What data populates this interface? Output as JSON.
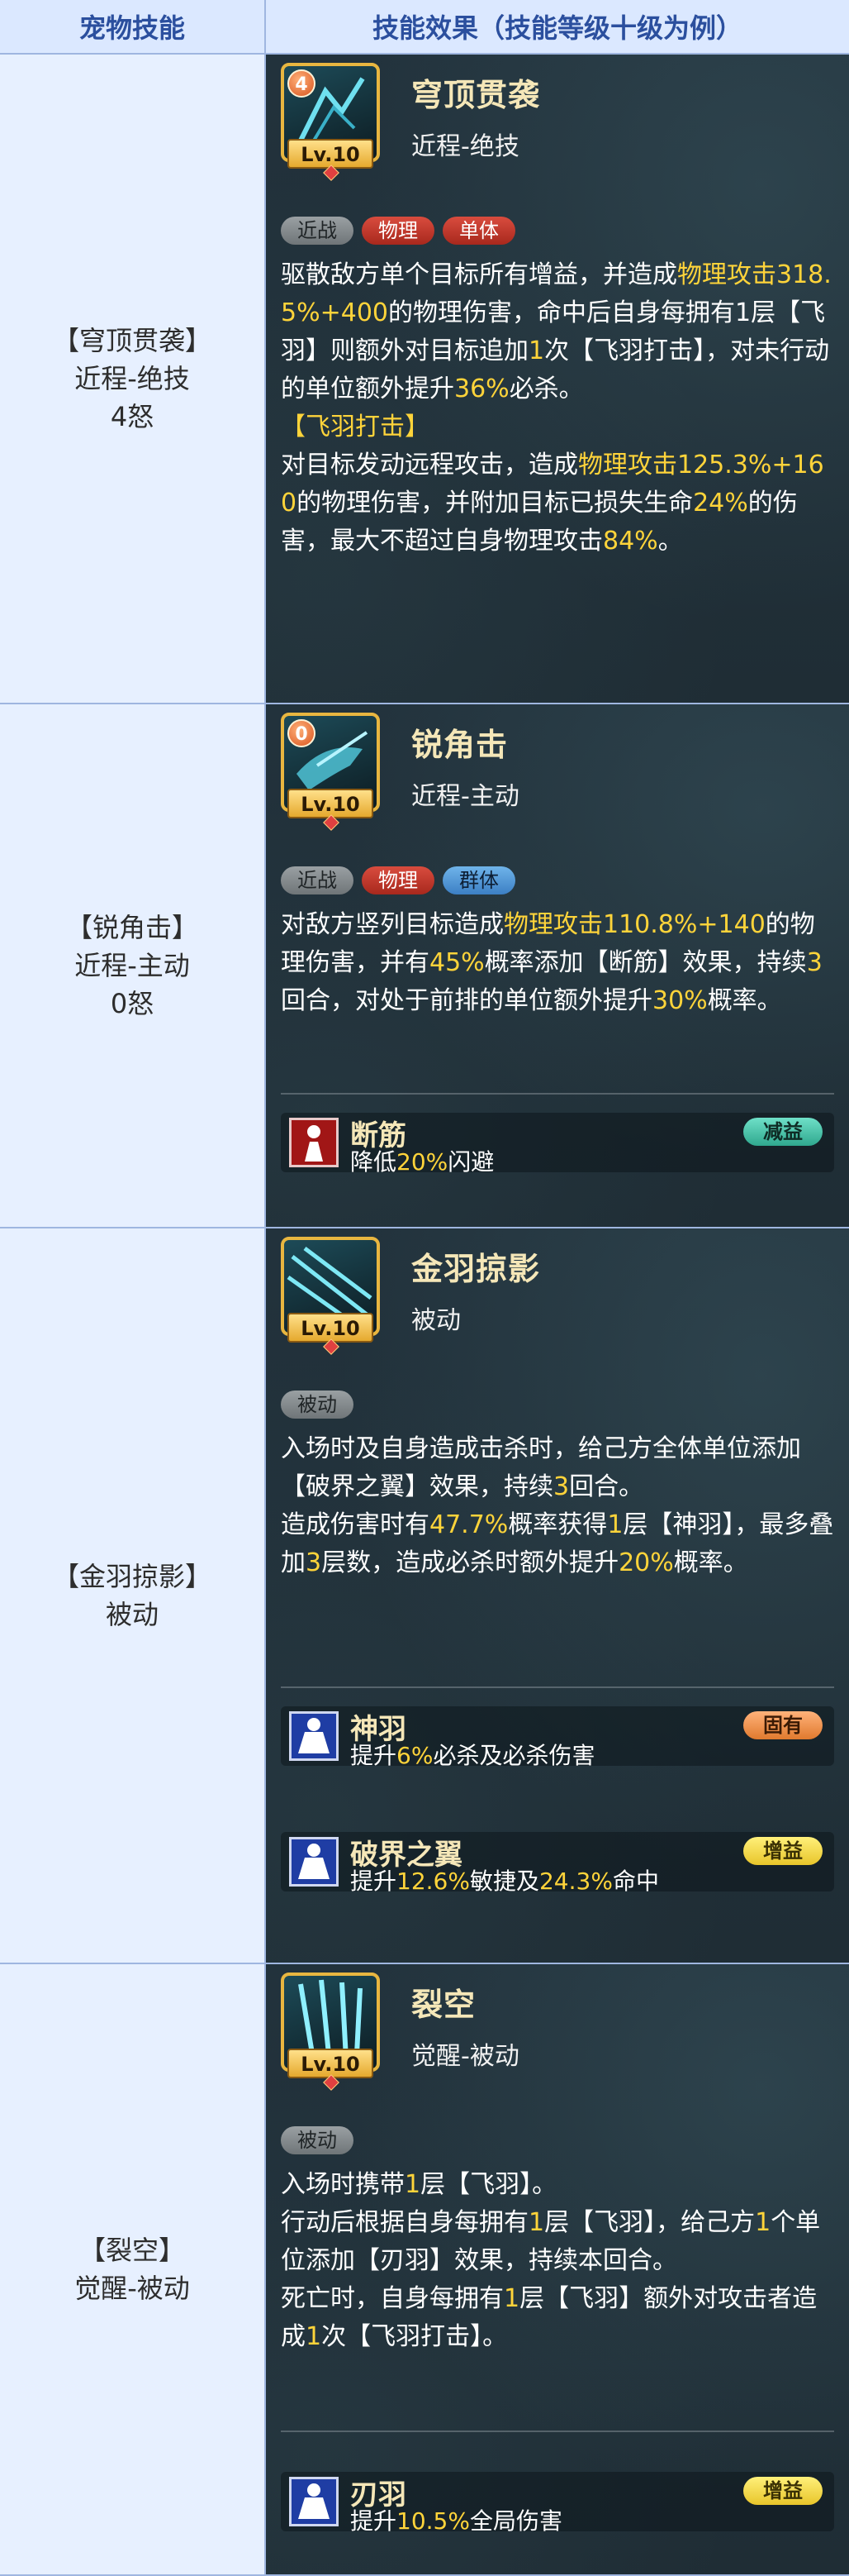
{
  "header": {
    "col1": "宠物技能",
    "col2": "技能效果（技能等级十级为例）"
  },
  "skills": [
    {
      "left": [
        "【穹顶贯袭】",
        "近程-绝技",
        "4怒"
      ],
      "name": "穹顶贯袭",
      "type": "近程-绝技",
      "level": "Lv.10",
      "rage": "4",
      "tags": [
        "近战",
        "物理",
        "单体"
      ],
      "desc": [
        {
          "t": "驱散敌方单个目标所有增益，并造成"
        },
        {
          "t": "物理攻击318.5%+400",
          "y": true
        },
        {
          "t": "的物理伤害，命中后自身每拥有1层【飞羽】则额外对目标追加"
        },
        {
          "t": "1",
          "y": true
        },
        {
          "t": "次【飞羽打击】，对未行动的单位额外提升"
        },
        {
          "t": "36%",
          "y": true
        },
        {
          "t": "必杀。"
        }
      ],
      "sub_title": "【飞羽打击】",
      "sub_desc": [
        {
          "t": "对目标发动远程攻击，造成"
        },
        {
          "t": "物理攻击125.3%+160",
          "y": true
        },
        {
          "t": "的物理伤害，并附加目标已损失生命"
        },
        {
          "t": "24%",
          "y": true
        },
        {
          "t": "的伤害，最大不超过自身物理攻击"
        },
        {
          "t": "84%",
          "y": true
        },
        {
          "t": "。"
        }
      ]
    },
    {
      "left": [
        "【锐角击】",
        "近程-主动",
        "0怒"
      ],
      "name": "锐角击",
      "type": "近程-主动",
      "level": "Lv.10",
      "rage": "0",
      "tags": [
        "近战",
        "物理",
        "群体"
      ],
      "desc": [
        {
          "t": "对敌方竖列目标造成"
        },
        {
          "t": "物理攻击110.8%+140",
          "y": true
        },
        {
          "t": "的物理伤害，并有"
        },
        {
          "t": "45%",
          "y": true
        },
        {
          "t": "概率添加【断筋】效果，持续"
        },
        {
          "t": "3",
          "y": true
        },
        {
          "t": "回合，对处于前排的单位额外提升"
        },
        {
          "t": "30%",
          "y": true
        },
        {
          "t": "概率。"
        }
      ],
      "buffs": [
        {
          "name": "断筋",
          "desc_pre": "降低",
          "desc_val": "20%",
          "desc_post": "闪避",
          "badge": "减益"
        }
      ]
    },
    {
      "left": [
        "【金羽掠影】",
        "被动"
      ],
      "name": "金羽掠影",
      "type": "被动",
      "level": "Lv.10",
      "tags": [
        "被动"
      ],
      "desc": [
        {
          "t": "入场时及自身造成击杀时，给己方全体单位添加【破界之翼】效果，持续"
        },
        {
          "t": "3",
          "y": true
        },
        {
          "t": "回合。"
        }
      ],
      "desc2": [
        {
          "t": "造成伤害时有"
        },
        {
          "t": "47.7%",
          "y": true
        },
        {
          "t": "概率获得"
        },
        {
          "t": "1",
          "y": true
        },
        {
          "t": "层【神羽】，最多叠加"
        },
        {
          "t": "3",
          "y": true
        },
        {
          "t": "层数，造成必杀时额外提升"
        },
        {
          "t": "20%",
          "y": true
        },
        {
          "t": "概率。"
        }
      ],
      "buffs": [
        {
          "name": "神羽",
          "desc_pre": "提升",
          "desc_val": "6%",
          "desc_post": "必杀及必杀伤害",
          "badge": "固有"
        },
        {
          "name": "破界之翼",
          "desc_pre": "提升",
          "desc_val": "12.6%",
          "desc_post": "敏捷及",
          "desc_val2": "24.3%",
          "desc_post2": "命中",
          "badge": "增益"
        }
      ]
    },
    {
      "left": [
        "【裂空】",
        "觉醒-被动"
      ],
      "name": "裂空",
      "type": "觉醒-被动",
      "level": "Lv.10",
      "tags": [
        "被动"
      ],
      "desc_lines": [
        [
          {
            "t": "入场时携带"
          },
          {
            "t": "1",
            "y": true
          },
          {
            "t": "层【飞羽】。"
          }
        ],
        [
          {
            "t": "行动后根据自身每拥有"
          },
          {
            "t": "1",
            "y": true
          },
          {
            "t": "层【飞羽】，给己方"
          },
          {
            "t": "1",
            "y": true
          },
          {
            "t": "个单位添加【刃羽】效果，持续本回合。"
          }
        ],
        [
          {
            "t": "死亡时，自身每拥有"
          },
          {
            "t": "1",
            "y": true
          },
          {
            "t": "层【飞羽】额外对攻击者造成"
          },
          {
            "t": "1",
            "y": true
          },
          {
            "t": "次【飞羽打击】。"
          }
        ]
      ],
      "buffs": [
        {
          "name": "刃羽",
          "desc_pre": "提升",
          "desc_val": "10.5%",
          "desc_post": "全局伤害",
          "badge": "增益"
        }
      ]
    }
  ]
}
